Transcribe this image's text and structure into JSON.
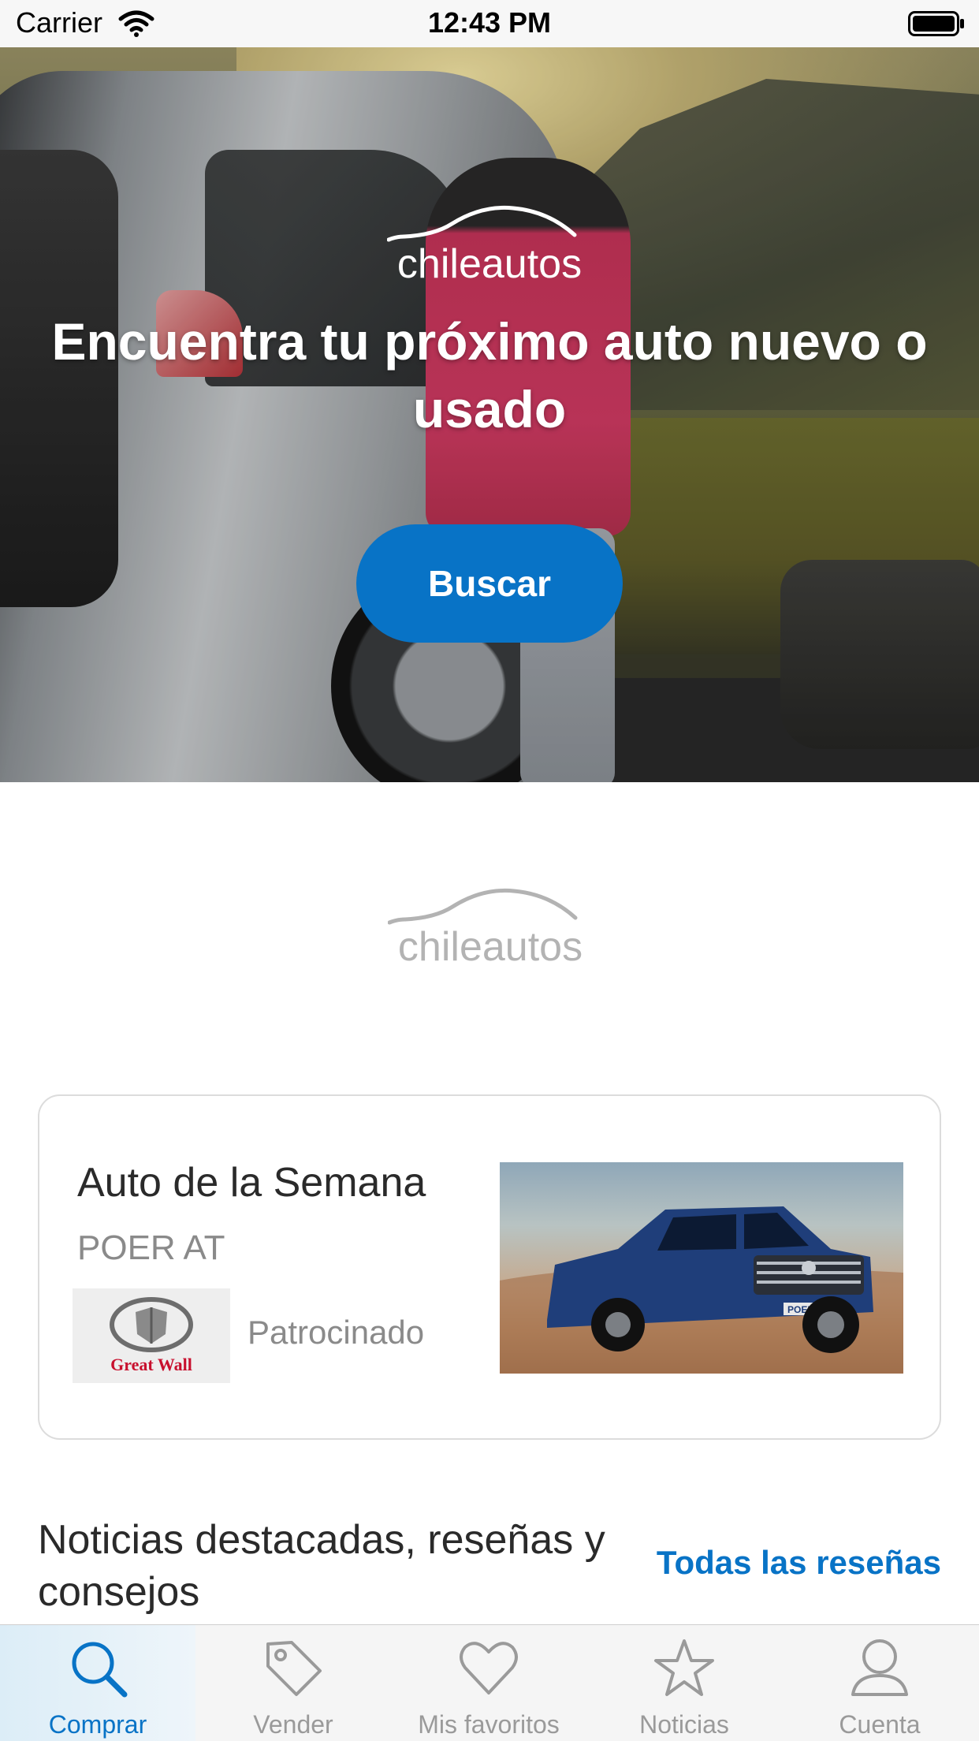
{
  "status_bar": {
    "carrier": "Carrier",
    "time": "12:43 PM"
  },
  "hero": {
    "logo_text": "chileautos",
    "headline": "Encuentra tu próximo auto nuevo o usado",
    "search_button": "Buscar"
  },
  "brand": {
    "logo_text": "chileautos"
  },
  "car_of_week": {
    "title": "Auto de la Semana",
    "model": "POER AT",
    "sponsor_logo_text": "Great Wall",
    "sponsored_label": "Patrocinado",
    "photo_badge": "POER"
  },
  "news": {
    "title": "Noticias destacadas, reseñas y consejos",
    "link": "Todas las reseñas"
  },
  "tab_bar": {
    "tabs": [
      {
        "label": "Comprar",
        "icon": "search-icon"
      },
      {
        "label": "Vender",
        "icon": "tag-icon"
      },
      {
        "label": "Mis favoritos",
        "icon": "heart-icon"
      },
      {
        "label": "Noticias",
        "icon": "star-icon"
      },
      {
        "label": "Cuenta",
        "icon": "account-icon"
      }
    ],
    "active_index": 0
  },
  "colors": {
    "accent": "#0873c6",
    "muted_text": "#8a8a8a",
    "card_border": "#dcdcdc"
  }
}
